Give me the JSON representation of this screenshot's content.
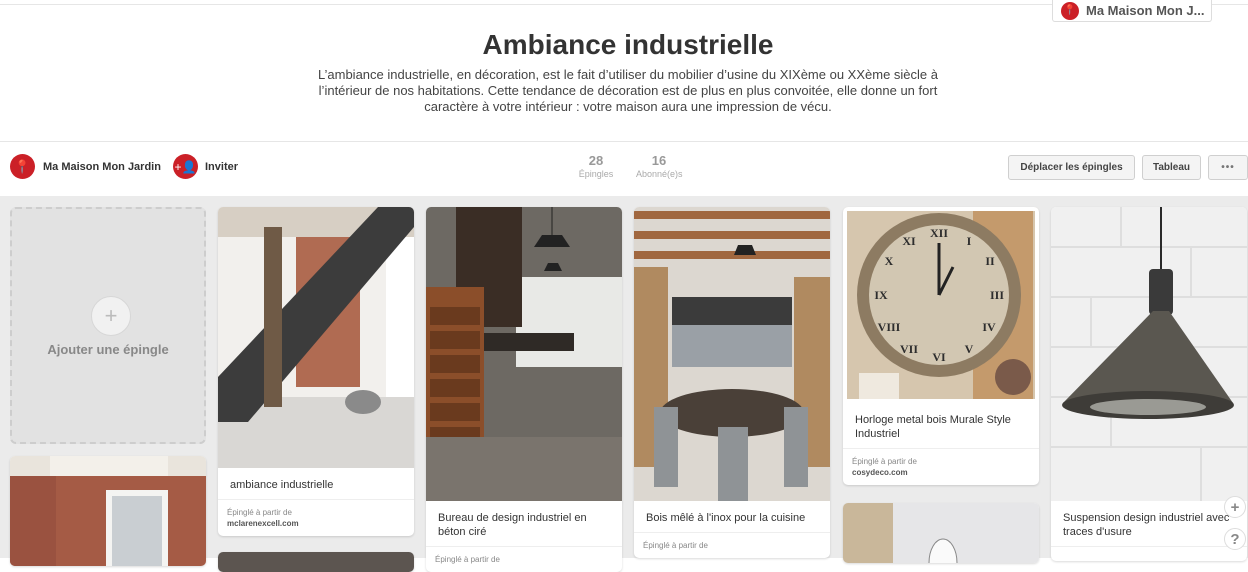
{
  "profile_chip": {
    "label": "Ma Maison Mon J..."
  },
  "board": {
    "title": "Ambiance industrielle",
    "description": "L’ambiance industrielle, en décoration, est le fait d’utiliser du mobilier d’usine du XIXème ou XXème siècle à l’intérieur de nos habitations. Cette tendance de décoration est de plus en plus convoitée, elle donne un fort caractère à votre intérieur : votre maison aura une impression de vécu."
  },
  "bar": {
    "owner": "Ma Maison Mon Jardin",
    "invite": "Inviter",
    "stats": [
      {
        "value": "28",
        "label": "Épingles"
      },
      {
        "value": "16",
        "label": "Abonné(e)s"
      }
    ],
    "buttons": {
      "move": "Déplacer les épingles",
      "board": "Tableau",
      "more": "•••"
    }
  },
  "add_pin": {
    "label": "Ajouter une épingle",
    "icon": "+"
  },
  "pins": [
    {
      "caption": "ambiance industrielle",
      "src_label": "Épinglé à partir de",
      "src": "mclarenexcell.com"
    },
    {
      "caption": "Bureau de design industriel en béton ciré",
      "src_label": "Épinglé à partir de",
      "src": ""
    },
    {
      "caption": "Bois mêlé à l'inox pour la cuisine",
      "src_label": "Épinglé à partir de",
      "src": ""
    },
    {
      "caption": "Horloge metal bois Murale Style Industriel",
      "src_label": "Épinglé à partir de",
      "src": "cosydeco.com"
    },
    {
      "caption": "Suspension design industriel avec traces d'usure",
      "src_label": "",
      "src": ""
    }
  ],
  "side_buttons": {
    "add": "+",
    "help": "?"
  },
  "colors": {
    "brand_red": "#cb2027",
    "background": "#ebebeb"
  }
}
